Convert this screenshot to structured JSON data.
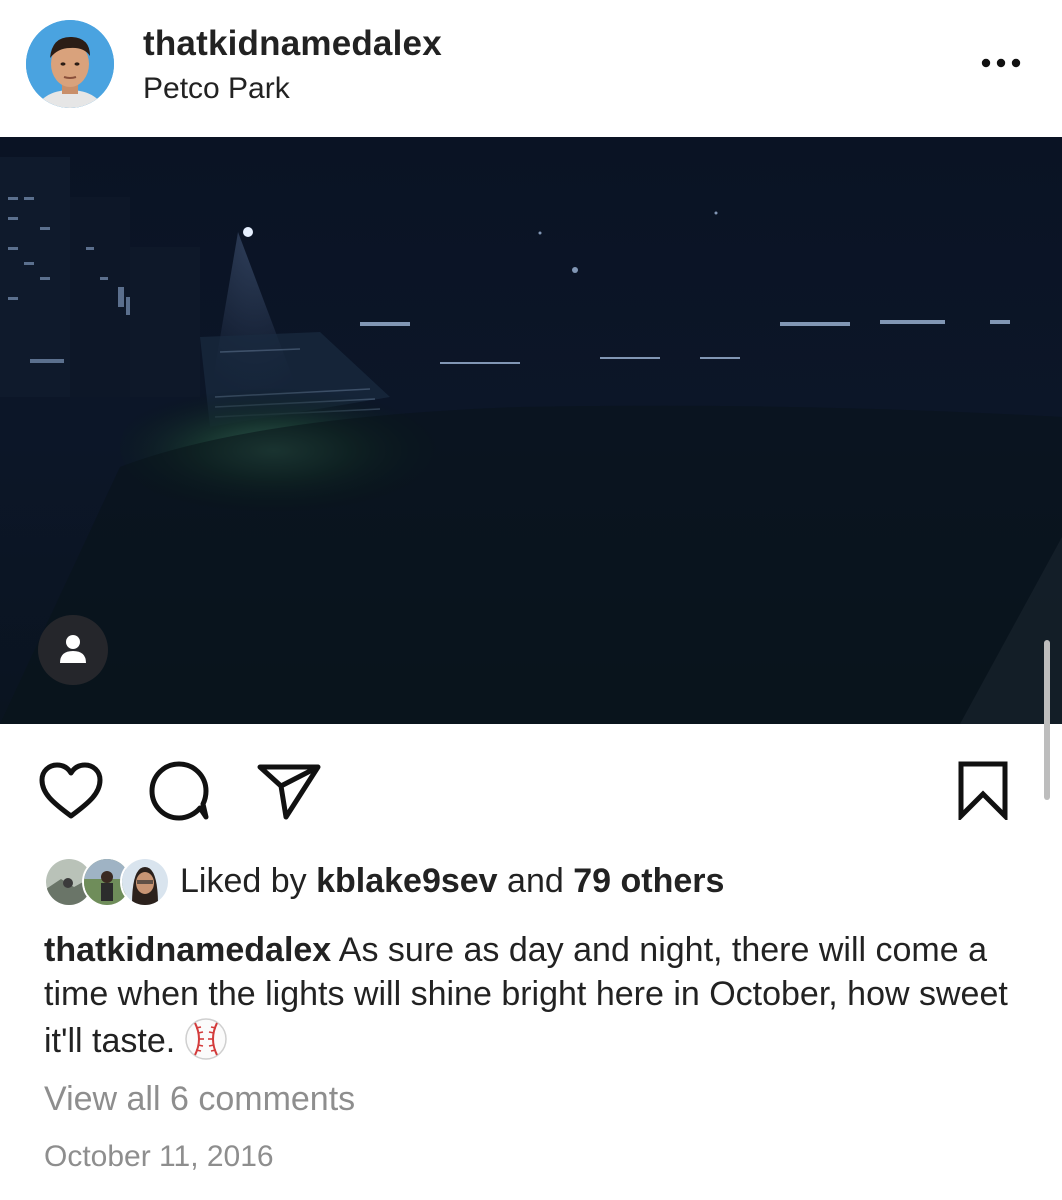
{
  "post": {
    "username": "thatkidnamedalex",
    "location": "Petco Park",
    "more_icon": "more-horizontal-icon"
  },
  "photo": {
    "tag_icon": "person-icon"
  },
  "actions": {
    "like_icon": "heart-icon",
    "comment_icon": "comment-icon",
    "share_icon": "paper-plane-icon",
    "save_icon": "bookmark-icon"
  },
  "likes": {
    "prefix": "Liked by ",
    "first_liker": "kblake9sev",
    "connector": " and ",
    "others": "79 others"
  },
  "caption": {
    "username": "thatkidnamedalex",
    "text": "As sure as day and night, there will come a time when the lights will shine bright here in October, how sweet it'll taste.",
    "emoji_icon": "baseball-icon"
  },
  "comments": {
    "view_all": "View all 6 comments"
  },
  "date": "October 11, 2016",
  "colors": {
    "text": "#222222",
    "muted": "#8e8e8e",
    "photo_bg": "#0b1220",
    "avatar_bg": "#4aa3e0"
  }
}
